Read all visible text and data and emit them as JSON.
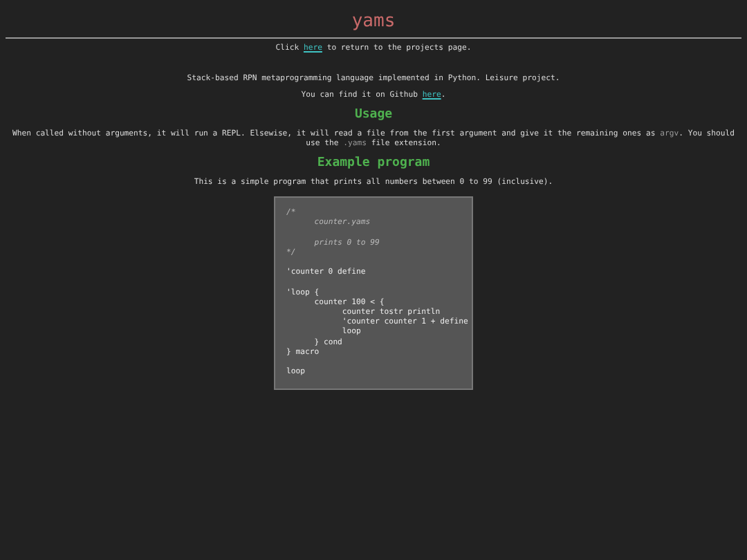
{
  "title": "yams",
  "intro": [
    {
      "text": "Click ",
      "kind": "text"
    },
    {
      "text": "here",
      "kind": "link"
    },
    {
      "text": " to return to the projects page.",
      "kind": "text"
    }
  ],
  "description": [
    [
      {
        "text": "Stack-based RPN metaprogramming language implemented in Python. Leisure project.",
        "kind": "text"
      }
    ],
    [
      {
        "text": "You can find it on Github ",
        "kind": "text"
      },
      {
        "text": "here",
        "kind": "link"
      },
      {
        "text": ".",
        "kind": "text"
      }
    ]
  ],
  "sections": [
    {
      "heading": "Usage",
      "paragraph": [
        {
          "text": "When called without arguments, it will run a REPL. Elsewise, it will read a file from the first argument and give it the remaining ones as ",
          "kind": "text"
        },
        {
          "text": "argv",
          "kind": "code"
        },
        {
          "text": ". You should use the ",
          "kind": "text"
        },
        {
          "text": ".yams",
          "kind": "code"
        },
        {
          "text": " file extension.",
          "kind": "text"
        }
      ]
    },
    {
      "heading": "Example program",
      "paragraph": [
        {
          "text": "This is a simple program that prints all numbers between 0 to 99 (inclusive).",
          "kind": "text"
        }
      ]
    }
  ],
  "code_blocks": [
    [
      {
        "text": "/*",
        "kind": "comment"
      },
      {
        "text": "\tcounter.yams",
        "kind": "comment"
      }
    ],
    [
      {
        "text": "\tprints 0 to 99",
        "kind": "comment"
      },
      {
        "text": "*/",
        "kind": "comment"
      }
    ],
    [
      {
        "text": "'counter 0 define",
        "kind": "code"
      }
    ],
    [
      {
        "text": "'loop {",
        "kind": "code"
      },
      {
        "text": "\tcounter 100 < {",
        "kind": "code"
      },
      {
        "text": "\t\tcounter tostr println",
        "kind": "code"
      },
      {
        "text": "\t\t'counter counter 1 + define",
        "kind": "code"
      },
      {
        "text": "\t\tloop",
        "kind": "code"
      },
      {
        "text": "\t} cond",
        "kind": "code"
      },
      {
        "text": "} macro",
        "kind": "code"
      }
    ],
    [
      {
        "text": "loop",
        "kind": "code"
      }
    ]
  ]
}
